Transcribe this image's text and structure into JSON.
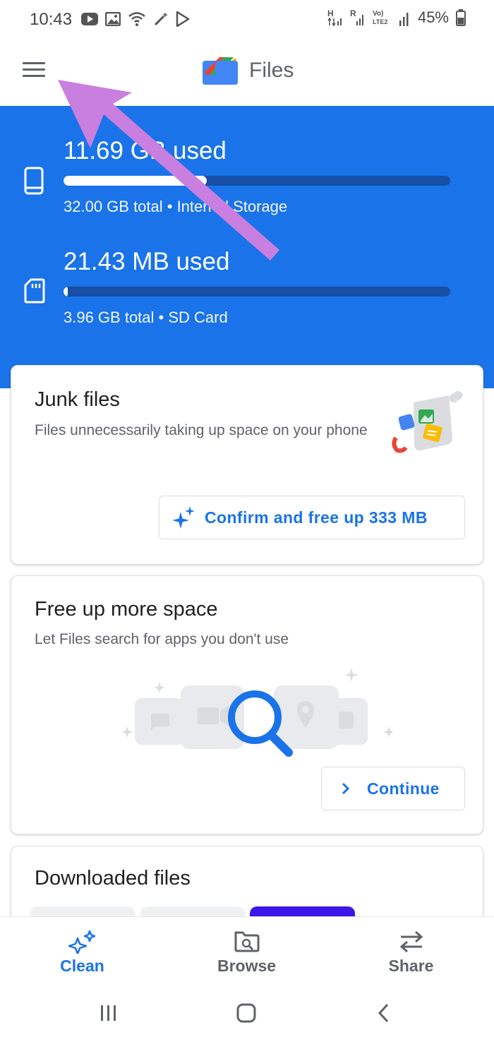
{
  "status_bar": {
    "time": "10:43",
    "battery_percent": "45%",
    "left_icons": [
      "youtube-icon",
      "gallery-icon",
      "wifi-call-icon",
      "magic-icon",
      "play-store-icon"
    ],
    "right_icons": [
      "network-h-icon",
      "network-r-icon",
      "volte-lte2-icon",
      "signal-icon",
      "battery-icon"
    ]
  },
  "app_bar": {
    "title": "Files",
    "menu_icon": "hamburger-menu-icon",
    "logo_icon": "files-logo-icon"
  },
  "storage": [
    {
      "used": "11.69 GB used",
      "total": "32.00 GB total • Internal Storage",
      "fill_fraction": 0.37,
      "icon": "phone-icon"
    },
    {
      "used": "21.43 MB used",
      "total": "3.96 GB total • SD Card",
      "fill_fraction": 0.01,
      "icon": "sd-card-icon"
    }
  ],
  "cards": {
    "junk": {
      "title": "Junk files",
      "description": "Files unnecessarily taking up space on your phone",
      "button_label": "Confirm and free up 333 MB",
      "button_icon": "sparkle-icon",
      "illustration": "cleaning-dustpan-icon"
    },
    "free_space": {
      "title": "Free up more space",
      "description": "Let Files search for apps you don't use",
      "button_label": "Continue",
      "button_icon": "chevron-right-icon",
      "illustration": "search-apps-illustration"
    },
    "downloaded": {
      "title": "Downloaded files"
    }
  },
  "bottom_nav": [
    {
      "label": "Clean",
      "icon": "sparkle-icon",
      "active": true
    },
    {
      "label": "Browse",
      "icon": "browse-folder-icon",
      "active": false
    },
    {
      "label": "Share",
      "icon": "swap-arrows-icon",
      "active": false
    }
  ],
  "system_nav": [
    "recents-icon",
    "home-icon",
    "back-icon"
  ],
  "colors": {
    "accent": "#1a73e8",
    "header_bg": "#1a73e8",
    "bar_track": "#174ea6",
    "annotation_arrow": "#c87fe0"
  }
}
